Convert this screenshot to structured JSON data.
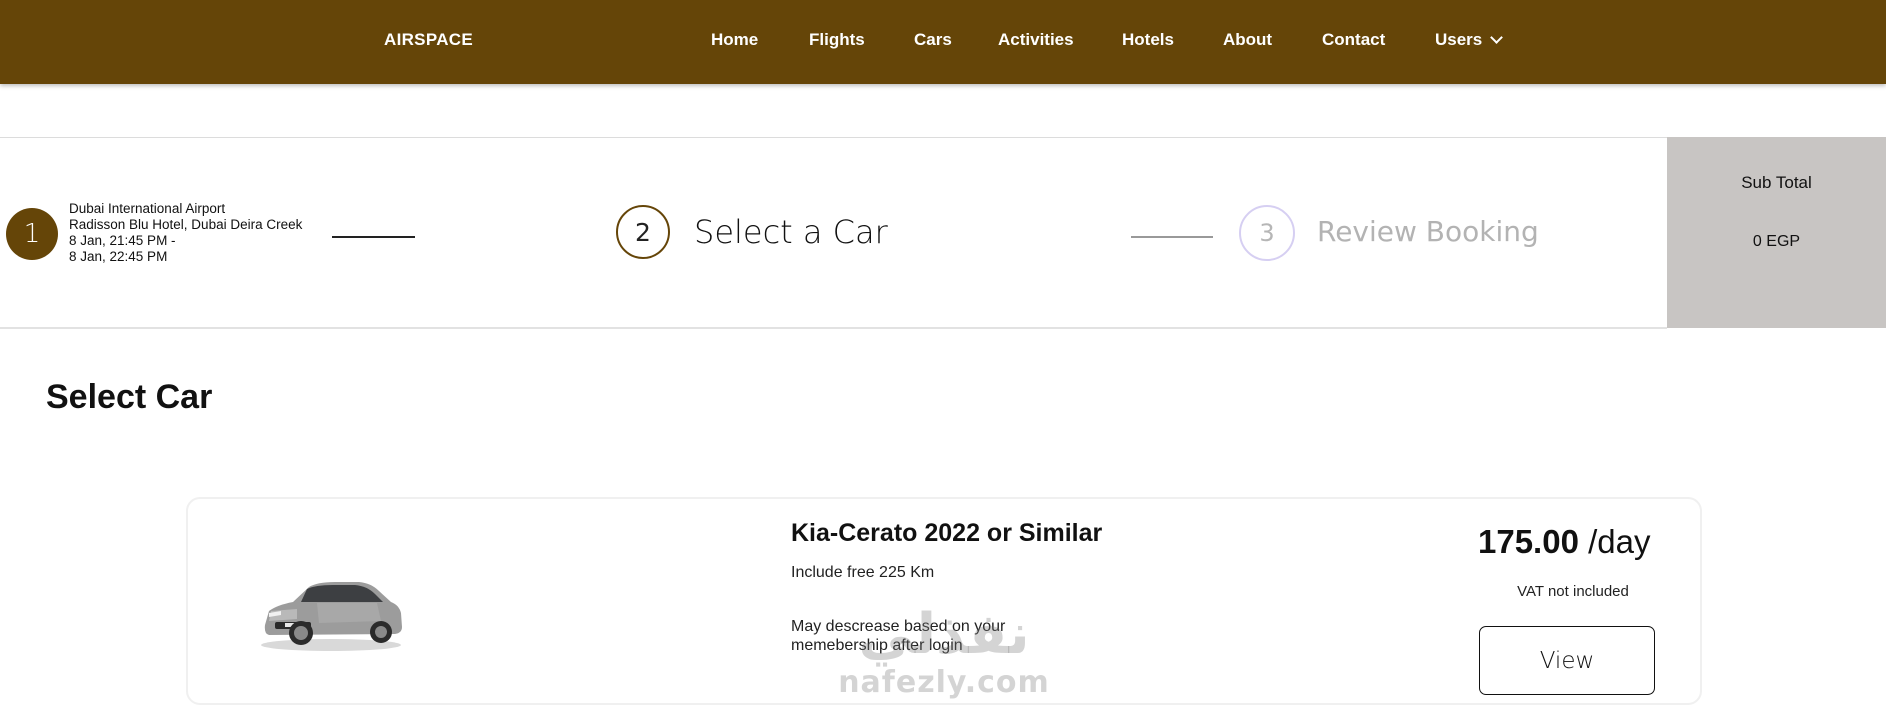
{
  "nav": {
    "brand": "AIRSPACE",
    "items": [
      {
        "label": "Home"
      },
      {
        "label": "Flights"
      },
      {
        "label": "Cars"
      },
      {
        "label": "Activities"
      },
      {
        "label": "Hotels"
      },
      {
        "label": "About"
      },
      {
        "label": "Contact"
      },
      {
        "label": "Users"
      }
    ],
    "background": "#654508"
  },
  "steps": [
    {
      "number": "1",
      "details": [
        "Dubai International Airport",
        "Radisson Blu Hotel, Dubai Deira Creek",
        "8 Jan, 21:45 PM -",
        "8 Jan, 22:45 PM"
      ]
    },
    {
      "number": "2",
      "label": "Select a Car"
    },
    {
      "number": "3",
      "label": "Review Booking"
    }
  ],
  "subtotal": {
    "label": "Sub Total",
    "value": "0 EGP"
  },
  "page_title": "Select Car",
  "car": {
    "name": "Kia-Cerato 2022 or Similar",
    "km": "Include free 225 Km",
    "note": "May descrease based on your memebership after login",
    "price": "175.00",
    "per": "/day",
    "vat": "VAT not included",
    "button": "View"
  },
  "watermark": {
    "arabic": "نفذلي",
    "latin": "nafezly.com"
  }
}
